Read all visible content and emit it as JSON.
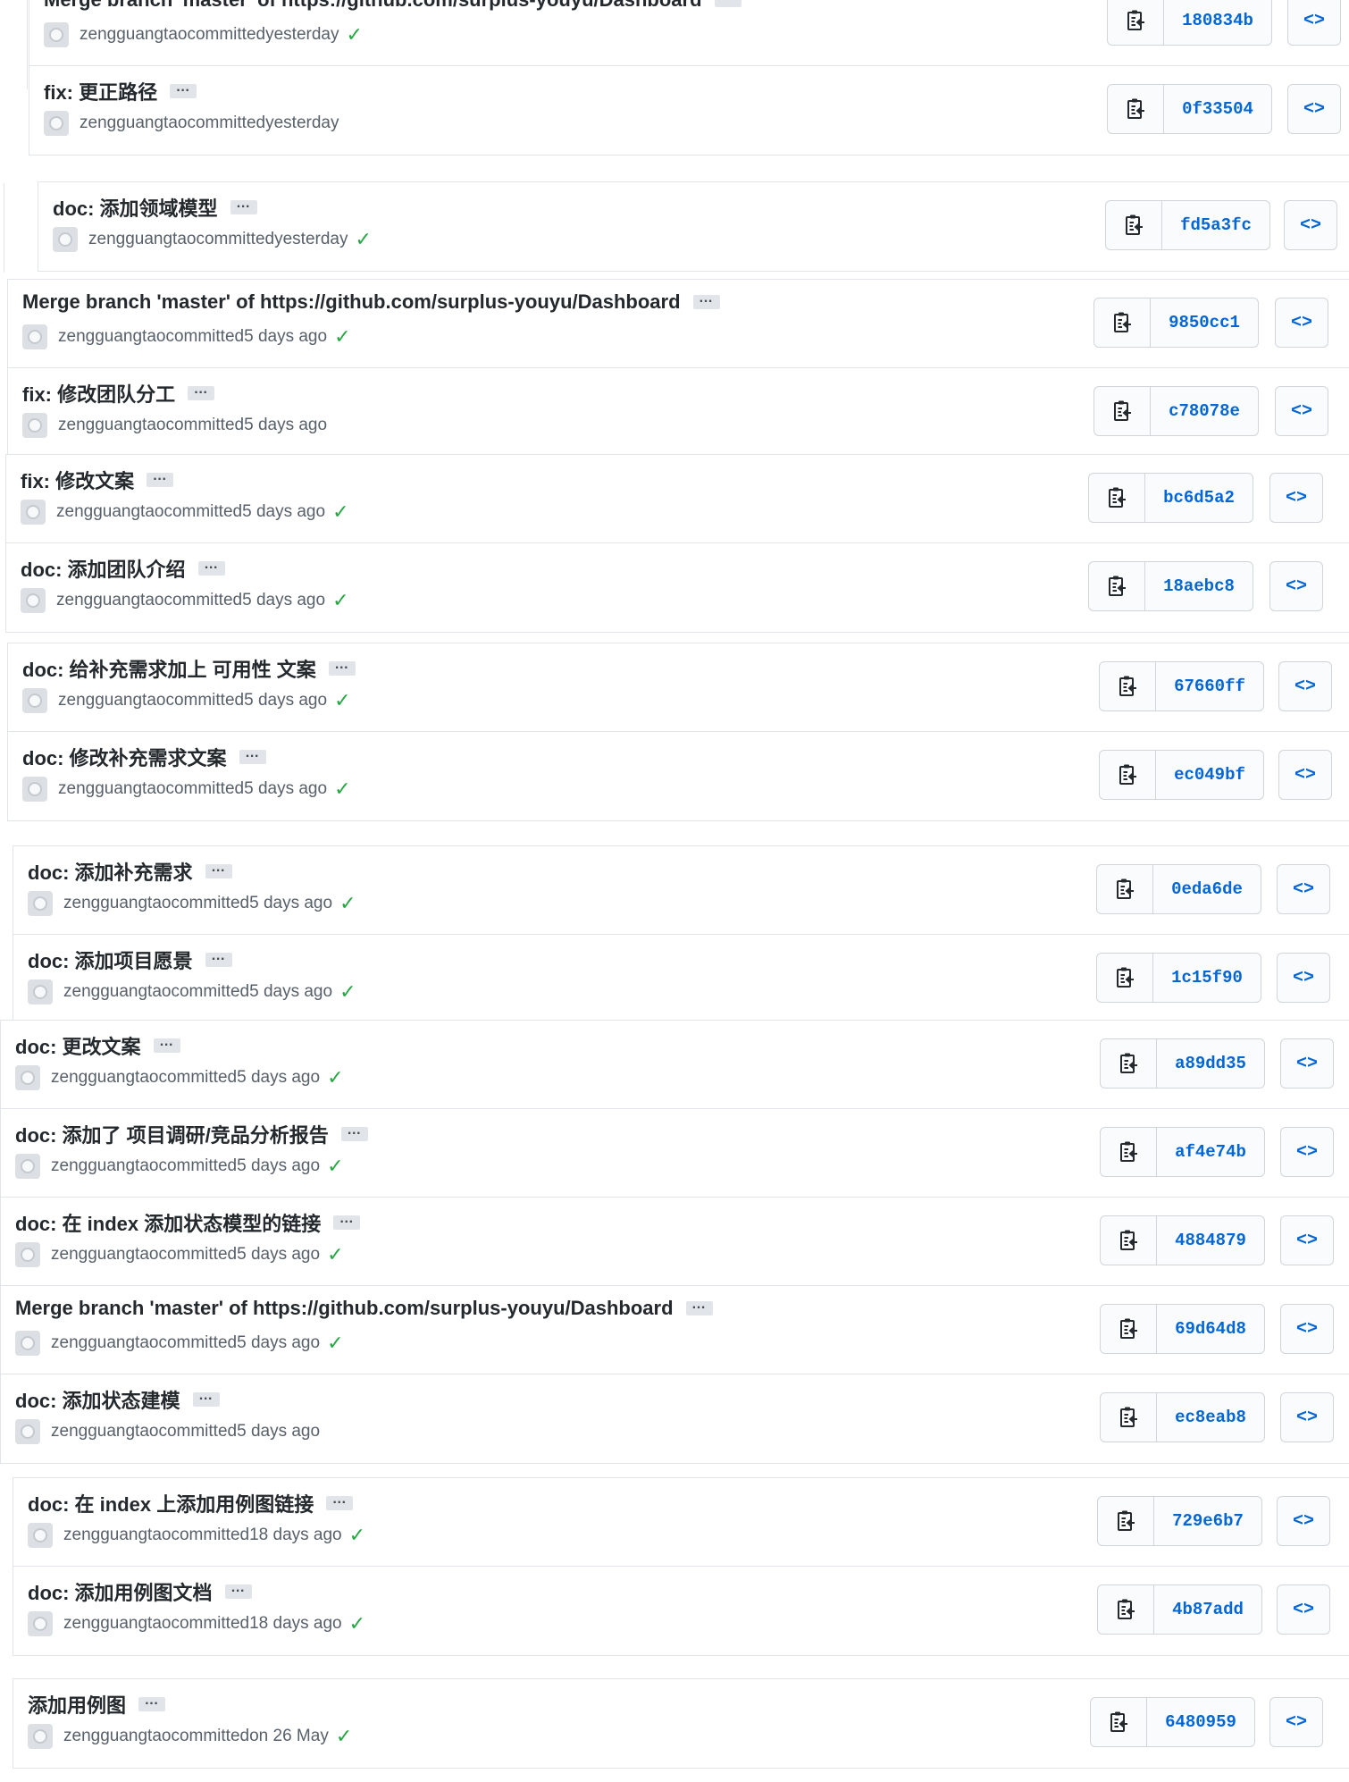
{
  "commits": [
    {
      "message": "Merge branch 'master' of https://github.com/surplus-youyu/Dashboard",
      "author": "zengguangtao",
      "action": "committed",
      "time": "yesterday",
      "verified": true,
      "sha": "180834b"
    },
    {
      "message": "fix: 更正路径",
      "author": "zengguangtao",
      "action": "committed",
      "time": "yesterday",
      "verified": false,
      "sha": "0f33504"
    },
    {
      "message": "doc: 添加领域模型",
      "author": "zengguangtao",
      "action": "committed",
      "time": "yesterday",
      "verified": true,
      "sha": "fd5a3fc"
    },
    {
      "message": "Merge branch 'master' of https://github.com/surplus-youyu/Dashboard",
      "author": "zengguangtao",
      "action": "committed",
      "time": "5 days ago",
      "verified": true,
      "sha": "9850cc1"
    },
    {
      "message": "fix: 修改团队分工",
      "author": "zengguangtao",
      "action": "committed",
      "time": "5 days ago",
      "verified": false,
      "sha": "c78078e"
    },
    {
      "message": "fix: 修改文案",
      "author": "zengguangtao",
      "action": "committed",
      "time": "5 days ago",
      "verified": true,
      "sha": "bc6d5a2"
    },
    {
      "message": "doc: 添加团队介绍",
      "author": "zengguangtao",
      "action": "committed",
      "time": "5 days ago",
      "verified": true,
      "sha": "18aebc8"
    },
    {
      "message": "doc: 给补充需求加上 可用性 文案",
      "author": "zengguangtao",
      "action": "committed",
      "time": "5 days ago",
      "verified": true,
      "sha": "67660ff"
    },
    {
      "message": "doc: 修改补充需求文案",
      "author": "zengguangtao",
      "action": "committed",
      "time": "5 days ago",
      "verified": true,
      "sha": "ec049bf"
    },
    {
      "message": "doc: 添加补充需求",
      "author": "zengguangtao",
      "action": "committed",
      "time": "5 days ago",
      "verified": true,
      "sha": "0eda6de"
    },
    {
      "message": "doc: 添加项目愿景",
      "author": "zengguangtao",
      "action": "committed",
      "time": "5 days ago",
      "verified": true,
      "sha": "1c15f90"
    },
    {
      "message": "doc: 更改文案",
      "author": "zengguangtao",
      "action": "committed",
      "time": "5 days ago",
      "verified": true,
      "sha": "a89dd35"
    },
    {
      "message": "doc: 添加了 项目调研/竞品分析报告",
      "author": "zengguangtao",
      "action": "committed",
      "time": "5 days ago",
      "verified": true,
      "sha": "af4e74b"
    },
    {
      "message": "doc: 在 index 添加状态模型的链接",
      "author": "zengguangtao",
      "action": "committed",
      "time": "5 days ago",
      "verified": true,
      "sha": "4884879"
    },
    {
      "message": "Merge branch 'master' of https://github.com/surplus-youyu/Dashboard",
      "author": "zengguangtao",
      "action": "committed",
      "time": "5 days ago",
      "verified": true,
      "sha": "69d64d8"
    },
    {
      "message": "doc: 添加状态建模",
      "author": "zengguangtao",
      "action": "committed",
      "time": "5 days ago",
      "verified": false,
      "sha": "ec8eab8"
    },
    {
      "message": "doc: 在 index 上添加用例图链接",
      "author": "zengguangtao",
      "action": "committed",
      "time": "18 days ago",
      "verified": true,
      "sha": "729e6b7"
    },
    {
      "message": "doc: 添加用例图文档",
      "author": "zengguangtao",
      "action": "committed",
      "time": "18 days ago",
      "verified": true,
      "sha": "4b87add"
    },
    {
      "message": "添加用例图",
      "author": "zengguangtao",
      "action": "committed",
      "time": "on 26 May",
      "verified": true,
      "sha": "6480959"
    }
  ],
  "icons": {
    "ellipsis": "…",
    "check": "✓",
    "browse": "<>",
    "copy": "clipboard-icon",
    "avatar": "avatar-icon"
  },
  "colors": {
    "sha": "#0366d6",
    "check": "#28a745",
    "border": "#e1e4e8",
    "text": "#24292e",
    "meta": "#586069"
  }
}
